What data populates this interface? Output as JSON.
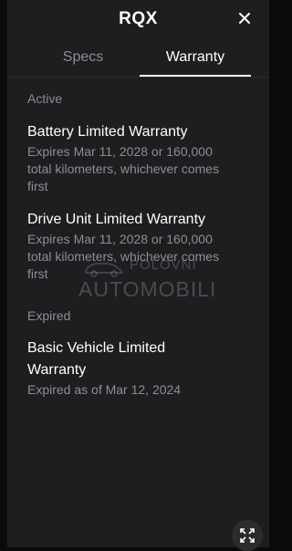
{
  "header": {
    "title": "RQX",
    "close_icon": "close-icon"
  },
  "tabs": [
    {
      "label": "Specs",
      "active": false
    },
    {
      "label": "Warranty",
      "active": true
    }
  ],
  "sections": {
    "active": {
      "label": "Active",
      "items": [
        {
          "title": "Battery Limited Warranty",
          "details": [
            "Expires Mar 11, 2028 or 160,000",
            "total kilometers, whichever comes",
            "first"
          ]
        },
        {
          "title": "Drive Unit Limited Warranty",
          "details": [
            "Expires Mar 11, 2028 or 160,000",
            "total kilometers, whichever comes",
            "first"
          ]
        }
      ]
    },
    "expired": {
      "label": "Expired",
      "items": [
        {
          "title_lines": [
            "Basic Vehicle Limited",
            "Warranty"
          ],
          "details": [
            "Expired as of Mar 12, 2024"
          ]
        }
      ]
    }
  },
  "watermark": {
    "line1": "POLOVNI",
    "line2": "AUTOMOBILI"
  },
  "expand_icon": "expand-icon",
  "colors": {
    "background": "#1e1e21",
    "text": "#ffffff",
    "muted": "#8e8e93"
  }
}
